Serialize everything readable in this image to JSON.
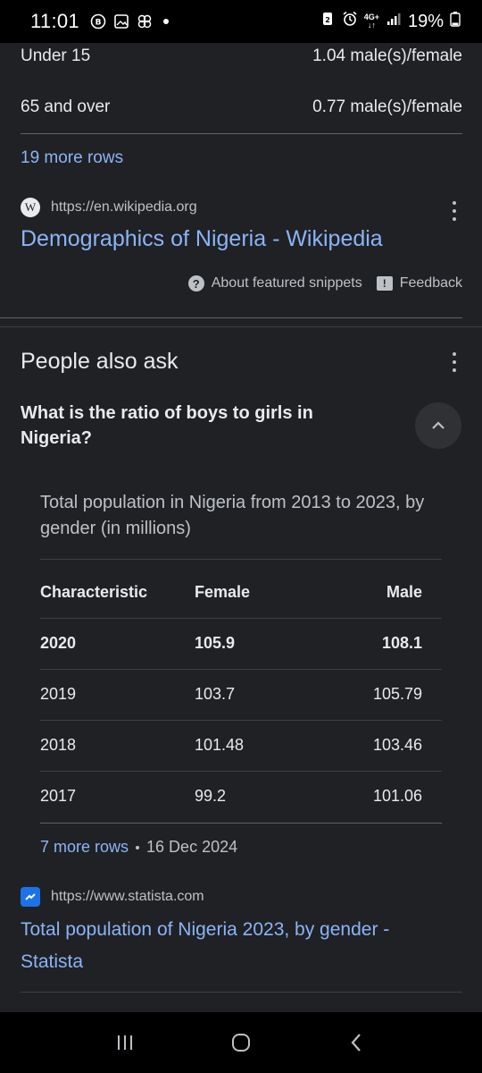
{
  "status_bar": {
    "time": "11:01",
    "network": "4G+",
    "battery": "19%"
  },
  "prev_table_rows": [
    {
      "label": "Under 15",
      "value": "1.04 male(s)/female"
    },
    {
      "label": "65 and over",
      "value": "0.77 male(s)/female"
    }
  ],
  "prev_more_rows": "19 more rows",
  "wiki_result": {
    "url": "https://en.wikipedia.org",
    "favicon_letter": "W",
    "title": "Demographics of Nigeria - Wikipedia"
  },
  "snippet_bar": {
    "about": "About featured snippets",
    "feedback": "Feedback"
  },
  "people_also_ask": {
    "title": "People also ask",
    "question": "What is the ratio of boys to girls in Nigeria?"
  },
  "answer_table": {
    "caption": "Total population in Nigeria from 2013 to 2023, by gender (in millions)",
    "headers": [
      "Characteristic",
      "Female",
      "Male"
    ],
    "rows": [
      [
        "2020",
        "105.9",
        "108.1"
      ],
      [
        "2019",
        "103.7",
        "105.79"
      ],
      [
        "2018",
        "101.48",
        "103.46"
      ],
      [
        "2017",
        "99.2",
        "101.06"
      ]
    ],
    "more_rows": "7 more rows",
    "date": "16 Dec 2024"
  },
  "statista_result": {
    "url": "https://www.statista.com",
    "title": "Total population of Nigeria 2023, by gender - Statista"
  },
  "icons": {
    "nav_recents": "recents-icon",
    "nav_home": "home-icon",
    "nav_back": "back-icon"
  },
  "colors": {
    "background": "#202124",
    "link": "#8ab4f8",
    "text": "#e8eaed"
  }
}
